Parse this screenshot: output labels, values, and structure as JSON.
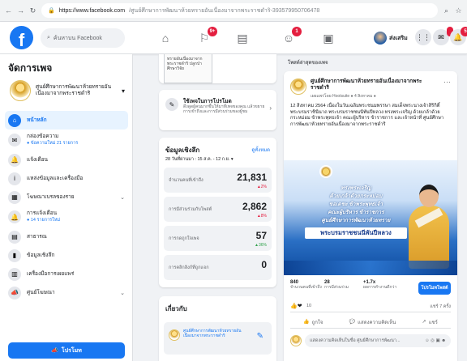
{
  "browser": {
    "url_host": "https://www.facebook.com",
    "url_path": "/ศูนย์ศึกษาการพัฒนาห้วยทรายอันเนื่องมาจากพระราชดำริ-393579950706478"
  },
  "header": {
    "search_placeholder": "ค้นหาบน Facebook",
    "badges": {
      "pages": "9+",
      "groups": "1"
    },
    "profile_name": "ส่งเสริม",
    "right_badges": {
      "messenger": "",
      "notifications": "5"
    }
  },
  "sidebar": {
    "title": "จัดการเพจ",
    "page_name": "ศูนย์ศึกษาการพัฒนาห้วยทรายอันเนื่องมาจากพระราชดำริ",
    "items": [
      {
        "label": "หน้าหลัก",
        "sub": "",
        "icon": "home-icon",
        "active": true
      },
      {
        "label": "กล่องข้อความ",
        "sub": "● ข้อความใหม่ 21 รายการ",
        "icon": "inbox-icon",
        "active": false
      },
      {
        "label": "แจ้งเตือน",
        "sub": "",
        "icon": "bell-icon",
        "active": false
      },
      {
        "label": "แหล่งข้อมูลและเครื่องมือ",
        "sub": "",
        "icon": "info-icon",
        "active": false
      },
      {
        "label": "โฆษณาเบรลของราย",
        "sub": "",
        "icon": "store-icon",
        "active": false,
        "caret": true
      },
      {
        "label": "การแจ้งเตือน",
        "sub": "● 14 รายการใหม่",
        "icon": "bell-icon",
        "active": false
      },
      {
        "label": "สาธารณ",
        "sub": "",
        "icon": "pages-icon",
        "active": false
      },
      {
        "label": "ข้อมูลเชิงลึก",
        "sub": "",
        "icon": "chart-icon",
        "active": false
      },
      {
        "label": "เครื่องมือการเผยแพร่",
        "sub": "",
        "icon": "publish-icon",
        "active": false
      },
      {
        "label": "ศูนย์โฆษณา",
        "sub": "",
        "icon": "megaphone-icon",
        "active": false,
        "caret": true
      }
    ],
    "promote_label": "โปรโมท"
  },
  "middle": {
    "doc_preview": "ทรายอันเนื่องมาจากพระราชดำริ ปลูกป่า ศึกษาวิจัย",
    "book_title": "ใช้เพจในการโปรโมต",
    "book_desc": "ดึงดูดผู้คนมากขึ้นให้มาที่เพจของคุณ แล้วขยายการเข้าถึงและการมีส่วนร่วมของผู้ชม",
    "insights_title": "ข้อมูลเชิงลึก",
    "insights_link": "ดูทั้งหมด",
    "insights_range": "28 วันที่ผ่านมา : 15 ส.ค. - 12 ก.ย. ▾",
    "metrics": [
      {
        "label": "จำนวนคนที่เข้าถึง",
        "value": "21,831",
        "change": "▲2%",
        "dir": "up"
      },
      {
        "label": "การมีส่วนร่วมกับโพสต์",
        "value": "2,862",
        "change": "▲8%",
        "dir": "up"
      },
      {
        "label": "การกดถูกใจเพจ",
        "value": "57",
        "change": "▲36%",
        "dir": "green"
      },
      {
        "label": "การคลิกลิงก์ที่ถูกแจก",
        "value": "0",
        "change": "",
        "dir": ""
      }
    ],
    "promo_title": "เกี่ยวกับ",
    "promo_text": "ศูนย์ศึกษาการพัฒนาห้วยทรายอันเนื่องมาจากพระราชดำริ"
  },
  "right": {
    "section_title": "โพสต์ล่าสุดของเพจ",
    "post": {
      "page_name": "ศูนย์ศึกษาการพัฒนาห้วยทรายอันเนื่องมาจากพระราชดำริ",
      "meta": "เผยแพร่โดย Hootsuite ● 4 สิงหาคม ●",
      "text": "12 สิงหาคม 2564 เนื่องในวันเฉลิมพระชนมพรรษา สมเด็จพระนางเจ้าสิริกิติ์ พระบรมราชินีนาถ พระบรมราชชนนีพันปีหลวง ทรงพระเจริญ ด้วยเกล้าด้วยกระหม่อม ข้าพระพุทธเจ้า คณะผู้บริหาร ข้าราชการ และเจ้าหน้าที่ ศูนย์ศึกษาการพัฒนาห้วยทรายอันเนื่องมาจากพระราชดำริ",
      "banner_lines": [
        "ทรงพระเจริญ",
        "ด้วยเกล้าด้วยกระหม่อม",
        "ขอเดชะ ข้าพระพุทธเจ้า",
        "คณะผู้บริหาร ข้าราชการ",
        "ศูนย์ศึกษาการพัฒนาห้วยทราย"
      ],
      "banner_highlight": "พระบรมราชชนนีพันปีหลวง",
      "stats": [
        {
          "value": "840",
          "label": "จำนวนคนที่เข้าถึง"
        },
        {
          "value": "28",
          "label": "การมีส่วนร่วม"
        },
        {
          "value": "+1.7x",
          "label": "ผลการทำงานดีกว่า"
        }
      ],
      "boost_label": "โปรโมทโพสต์",
      "reaction_count": "10",
      "share_count": "แชร์ 7 ครั้ง",
      "actions": [
        "ถูกใจ",
        "แสดงความคิดเห็น",
        "แชร์"
      ],
      "comment_placeholder": "แสดงความคิดเห็นในชื่อ ศูนย์ศึกษาการพัฒนา..."
    }
  }
}
